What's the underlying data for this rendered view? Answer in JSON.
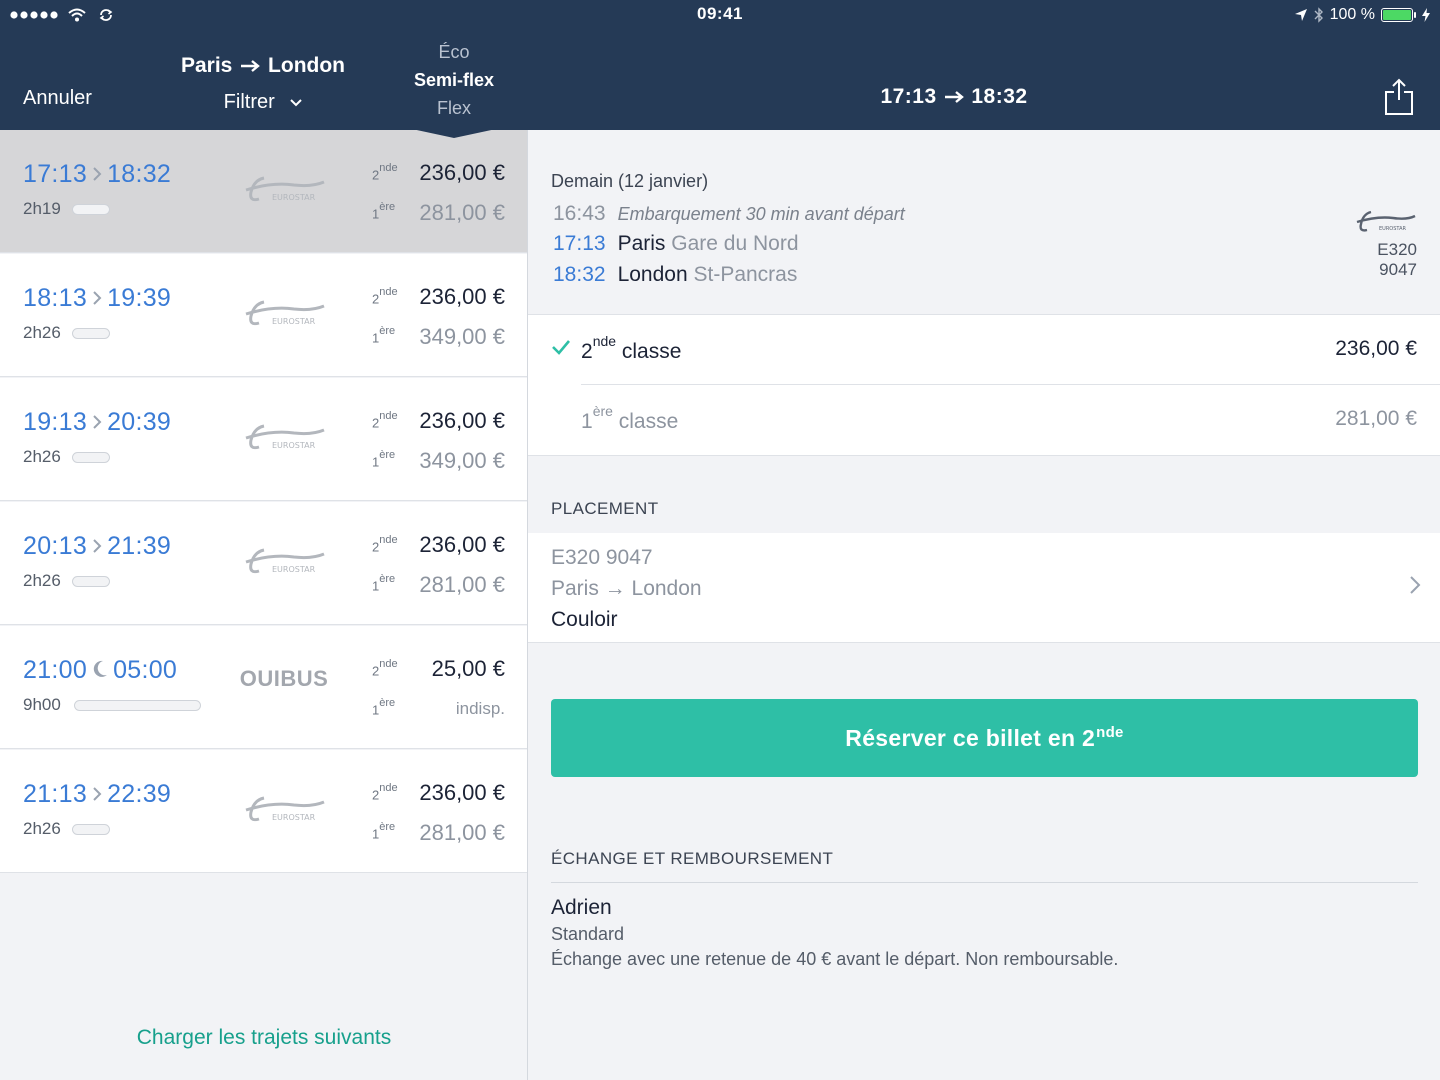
{
  "status_bar": {
    "time": "09:41",
    "battery": "100 %",
    "battery_level": 1.0
  },
  "header": {
    "cancel_label": "Annuler",
    "route_from": "Paris",
    "route_to": "London",
    "filter_label": "Filtrer",
    "fare_options": [
      "Éco",
      "Semi-flex",
      "Flex"
    ],
    "fare_selected": "Semi-flex",
    "detail_title_from": "17:13",
    "detail_title_to": "18:32"
  },
  "trips": [
    {
      "dep": "17:13",
      "arr": "18:32",
      "separator": "chevron",
      "duration": "2h19",
      "duration_fraction": 0.15,
      "operator": "EUROSTAR",
      "class2_label": "2",
      "class2_sup": "nde",
      "class2_price": "236,00 €",
      "class1_label": "1",
      "class1_sup": "ère",
      "class1_price": "281,00 €",
      "selected": true
    },
    {
      "dep": "18:13",
      "arr": "19:39",
      "separator": "chevron",
      "duration": "2h26",
      "duration_fraction": 0.15,
      "operator": "EUROSTAR",
      "class2_label": "2",
      "class2_sup": "nde",
      "class2_price": "236,00 €",
      "class1_label": "1",
      "class1_sup": "ère",
      "class1_price": "349,00 €",
      "selected": false
    },
    {
      "dep": "19:13",
      "arr": "20:39",
      "separator": "chevron",
      "duration": "2h26",
      "duration_fraction": 0.15,
      "operator": "EUROSTAR",
      "class2_label": "2",
      "class2_sup": "nde",
      "class2_price": "236,00 €",
      "class1_label": "1",
      "class1_sup": "ère",
      "class1_price": "349,00 €",
      "selected": false
    },
    {
      "dep": "20:13",
      "arr": "21:39",
      "separator": "chevron",
      "duration": "2h26",
      "duration_fraction": 0.15,
      "operator": "EUROSTAR",
      "class2_label": "2",
      "class2_sup": "nde",
      "class2_price": "236,00 €",
      "class1_label": "1",
      "class1_sup": "ère",
      "class1_price": "281,00 €",
      "selected": false
    },
    {
      "dep": "21:00",
      "arr": "05:00",
      "separator": "moon",
      "duration": "9h00",
      "duration_fraction": 0.5,
      "operator": "OUIBUS",
      "class2_label": "2",
      "class2_sup": "nde",
      "class2_price": "25,00 €",
      "class1_label": "1",
      "class1_sup": "ère",
      "class1_price": "indisp.",
      "selected": false
    },
    {
      "dep": "21:13",
      "arr": "22:39",
      "separator": "chevron",
      "duration": "2h26",
      "duration_fraction": 0.15,
      "operator": "EUROSTAR",
      "class2_label": "2",
      "class2_sup": "nde",
      "class2_price": "236,00 €",
      "class1_label": "1",
      "class1_sup": "ère",
      "class1_price": "281,00 €",
      "selected": false
    }
  ],
  "load_more_label": "Charger les trajets suivants",
  "detail": {
    "date": "Demain (12 janvier)",
    "boarding_time": "16:43",
    "boarding_note": "Embarquement 30 min avant départ",
    "dep_time": "17:13",
    "dep_city": "Paris",
    "dep_station": "Gare du Nord",
    "arr_time": "18:32",
    "arr_city": "London",
    "arr_station": "St-Pancras",
    "train_type": "E320",
    "train_number": "9047",
    "operator": "EUROSTAR",
    "class2_num": "2",
    "class2_sup": "nde",
    "class2_word": "classe",
    "class2_price": "236,00 €",
    "class1_num": "1",
    "class1_sup": "ère",
    "class1_word": "classe",
    "class1_price": "281,00 €",
    "placement_title": "PLACEMENT",
    "placement_train": "E320 9047",
    "placement_route": "Paris → London",
    "placement_seat": "Couloir",
    "book_label": "Réserver ce billet en 2",
    "book_sup": "nde",
    "exchange_title": "ÉCHANGE ET REMBOURSEMENT",
    "exchange_name": "Adrien",
    "exchange_type": "Standard",
    "exchange_desc": "Échange avec une retenue de 40 € avant le départ. Non remboursable."
  },
  "colors": {
    "header_bg": "#253a56",
    "accent_blue": "#3a7bd5",
    "accent_green": "#2ebfa6",
    "link_green": "#17a08c"
  },
  "icons": [
    "signal-dots-icon",
    "wifi-icon",
    "sync-icon",
    "location-arrow-icon",
    "bluetooth-icon",
    "battery-icon",
    "charging-bolt-icon",
    "chevron-down-icon",
    "share-icon",
    "chevron-right-icon",
    "moon-icon",
    "check-icon",
    "eurostar-logo",
    "ouibus-logo"
  ]
}
